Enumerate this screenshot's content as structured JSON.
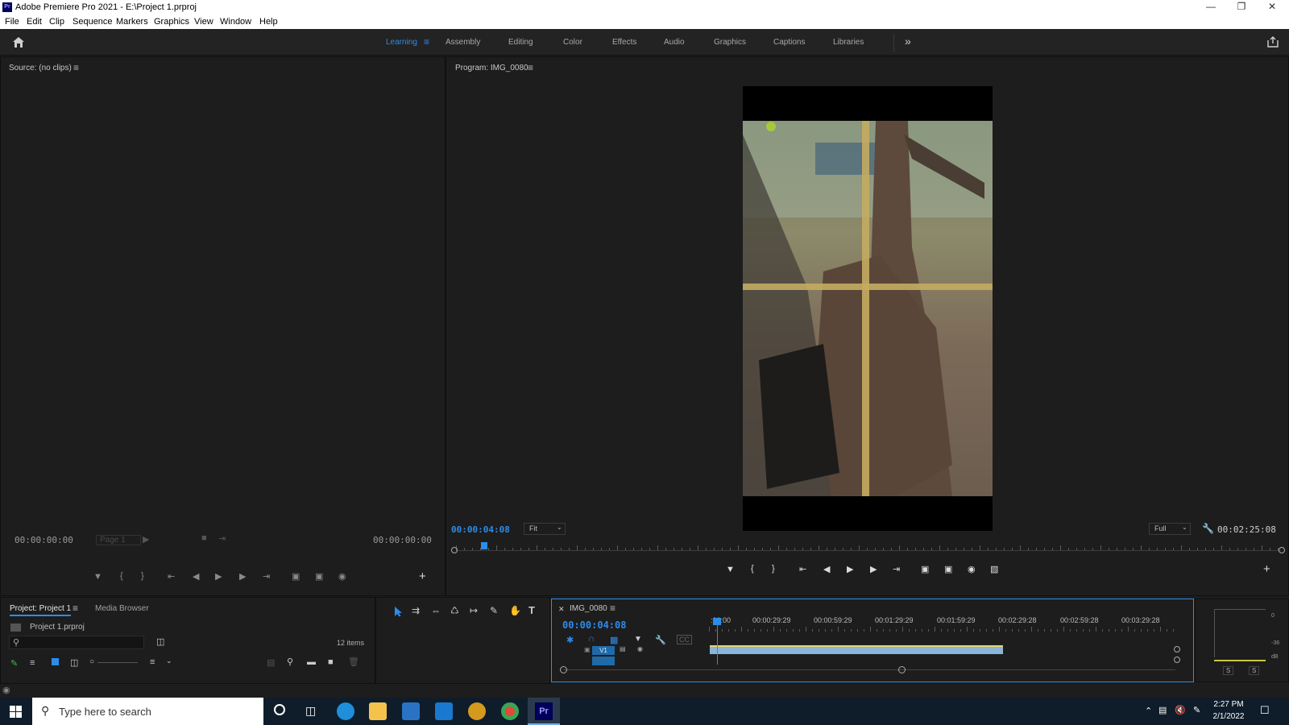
{
  "window": {
    "app_icon": "Pr",
    "title": "Adobe Premiere Pro 2021 - E:\\Project 1.prproj",
    "minimize_icon": "minimize-icon",
    "restore_icon": "restore-icon",
    "close_icon": "close-icon"
  },
  "menu": [
    "File",
    "Edit",
    "Clip",
    "Sequence",
    "Markers",
    "Graphics",
    "View",
    "Window",
    "Help"
  ],
  "workspaces": {
    "active": "Learning",
    "items": [
      "Learning",
      "Assembly",
      "Editing",
      "Color",
      "Effects",
      "Audio",
      "Graphics",
      "Captions",
      "Libraries"
    ],
    "more_label": "»"
  },
  "source_monitor": {
    "title": "Source: (no clips)",
    "timecode_in": "00:00:00:00",
    "page_label": "Page 1",
    "timecode_out": "00:00:00:00"
  },
  "program_monitor": {
    "title": "Program: IMG_0080",
    "timecode": "00:00:04:08",
    "fit_label": "Fit",
    "quality_label": "Full",
    "duration": "00:02:25:08",
    "playhead_fraction": 0.03
  },
  "project_panel": {
    "tab_active": "Project: Project 1",
    "tab_other": "Media Browser",
    "file_name": "Project 1.prproj",
    "item_count": "12 items"
  },
  "timeline": {
    "sequence_name": "IMG_0080",
    "timecode": "00:00:04:08",
    "ruler_labels": [
      ":00:00",
      "00:00:29:29",
      "00:00:59:29",
      "00:01:29:29",
      "00:01:59:29",
      "00:02:29:28",
      "00:02:59:28",
      "00:03:29:28"
    ],
    "track_label": "V1",
    "clip_fraction": 0.63
  },
  "audio_meter": {
    "labels": [
      "0",
      "-36",
      "dB"
    ],
    "solo_labels": [
      "S",
      "S"
    ]
  },
  "taskbar": {
    "search_placeholder": "Type here to search",
    "time": "2:27 PM",
    "date": "2/1/2022"
  },
  "colors": {
    "accent": "#2d8ceb",
    "clip": "#8ab4d8",
    "clip_top": "#e6d36a"
  }
}
